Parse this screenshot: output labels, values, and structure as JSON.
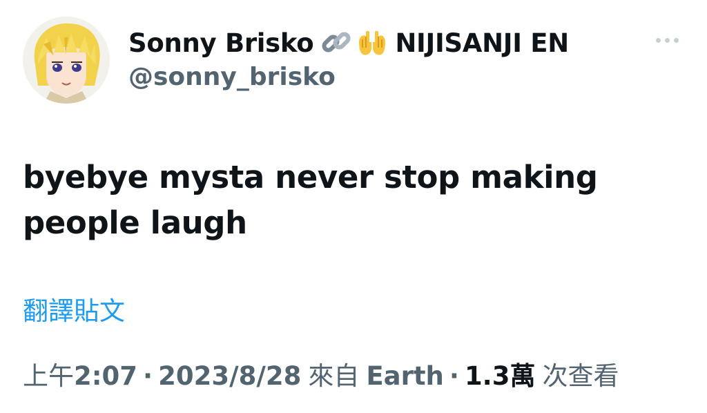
{
  "author": {
    "display_name": "Sonny Brisko",
    "emoji_1": "link-emoji",
    "emoji_2": "palms-up-together-emoji",
    "affiliation": "NIJISANJI EN",
    "handle": "@sonny_brisko",
    "avatar_icon": "avatar-image"
  },
  "tweet": {
    "text": "byebye mysta never stop making people laugh"
  },
  "translate": {
    "label": "翻譯貼文"
  },
  "meta": {
    "time_prefix": "上午",
    "time": "2:07",
    "separator_1": "·",
    "date": "2023/8/28",
    "source_prefix": "來自",
    "source": "Earth",
    "separator_2": "·",
    "views_count": "1.3萬",
    "views_label": "次查看"
  },
  "colors": {
    "primary_text": "#0f1419",
    "secondary_text": "#536471",
    "link": "#1d9bf0",
    "more_dots": "#c4cfd6"
  },
  "icons": {
    "more": "more-options-icon"
  }
}
